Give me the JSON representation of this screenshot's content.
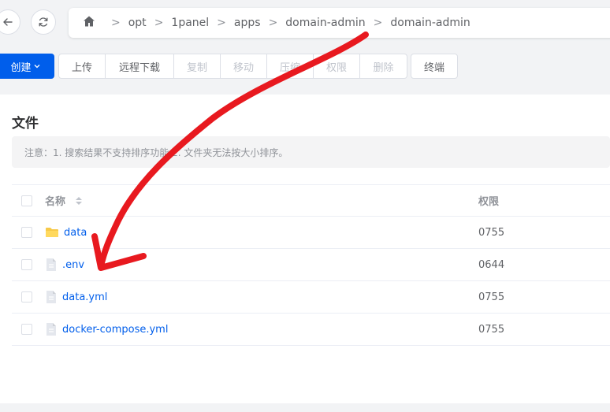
{
  "nav": {
    "back_icon": "arrow-left-icon",
    "refresh_icon": "refresh-icon",
    "home_icon": "home-icon",
    "breadcrumbs": [
      "opt",
      "1panel",
      "apps",
      "domain-admin",
      "domain-admin"
    ],
    "separator": ">"
  },
  "toolbar": {
    "create_label": "创建",
    "buttons": [
      {
        "label": "上传",
        "enabled": true
      },
      {
        "label": "远程下载",
        "enabled": true
      },
      {
        "label": "复制",
        "enabled": false
      },
      {
        "label": "移动",
        "enabled": false
      },
      {
        "label": "压缩",
        "enabled": false
      },
      {
        "label": "权限",
        "enabled": false
      },
      {
        "label": "删除",
        "enabled": false
      }
    ],
    "terminal_label": "终端"
  },
  "panel": {
    "title": "文件",
    "notice": "注意：1. 搜索结果不支持排序功能 2. 文件夹无法按大小排序。"
  },
  "table": {
    "columns": {
      "name": "名称",
      "permission": "权限"
    },
    "rows": [
      {
        "name": "data",
        "type": "folder",
        "permission": "0755"
      },
      {
        "name": ".env",
        "type": "file",
        "permission": "0644"
      },
      {
        "name": "data.yml",
        "type": "file",
        "permission": "0755"
      },
      {
        "name": "docker-compose.yml",
        "type": "file",
        "permission": "0755"
      }
    ]
  },
  "colors": {
    "primary": "#005eeb",
    "annotation": "#e8191f",
    "folder": "#f7c948"
  }
}
